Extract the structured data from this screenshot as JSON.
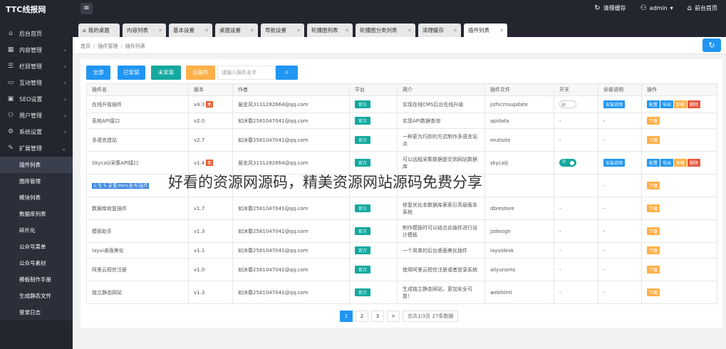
{
  "header": {
    "logo": "TTC线报网",
    "menu_icon": "hamburger-icon",
    "clear_cache": "清理缓存",
    "user": "admin",
    "frontend": "前台首页"
  },
  "sidebar": {
    "items": [
      {
        "label": "后台首页",
        "icon": "home-icon"
      },
      {
        "label": "内容管理",
        "icon": "grid-icon"
      },
      {
        "label": "栏目管理",
        "icon": "list-icon"
      },
      {
        "label": "互动管理",
        "icon": "chat-icon"
      },
      {
        "label": "SEO设置",
        "icon": "monitor-icon"
      },
      {
        "label": "用户管理",
        "icon": "user-icon"
      },
      {
        "label": "系统设置",
        "icon": "gear-icon"
      },
      {
        "label": "扩展管理",
        "icon": "puzzle-icon"
      }
    ],
    "sub_items": [
      "插件列表",
      "图库管理",
      "模块列表",
      "数据库列表",
      "碎片化",
      "公众号菜单",
      "公众号素材",
      "模板制作手册",
      "生成静态文件",
      "登录日志"
    ]
  },
  "tabs": [
    {
      "label": "我的桌面"
    },
    {
      "label": "内容列表"
    },
    {
      "label": "基本设置"
    },
    {
      "label": "桌面设置"
    },
    {
      "label": "导航设置"
    },
    {
      "label": "轮播图列表"
    },
    {
      "label": "轮播图分类列表"
    },
    {
      "label": "清理缓存"
    },
    {
      "label": "插件列表"
    }
  ],
  "breadcrumb": {
    "home": "首页",
    "parent": "插件管理",
    "current": "插件列表"
  },
  "toolbar": {
    "all": "全部",
    "installed": "已安装",
    "uninstalled": "未安装",
    "cloud": "云插件",
    "search_placeholder": "请输入插件名字"
  },
  "table": {
    "headers": [
      "插件名",
      "版本",
      "作者",
      "平台",
      "简介",
      "插件文件",
      "开关",
      "安装说明",
      "操作"
    ],
    "rows": [
      {
        "name": "在线升级插件",
        "version": "v4.3",
        "new": "新",
        "author": "届忠风3131282664@qq.com",
        "platform": "官方",
        "desc": "实现在线CMS后台在线升级",
        "file": "jizhicmsupdate",
        "switch": "off",
        "install_note": "安装说明",
        "ops": [
          "配置",
          "导出",
          "卸载",
          "删除"
        ]
      },
      {
        "name": "系统API接口",
        "version": "v2.0",
        "new": "",
        "author": "如沐春2581047041@qq.com",
        "platform": "官方",
        "desc": "实现API数据查询",
        "file": "apidata",
        "switch": "-",
        "install_note": "-",
        "ops": [
          "下载"
        ]
      },
      {
        "name": "多语言建站",
        "version": "v2.7",
        "new": "",
        "author": "如沐春2581047041@qq.com",
        "platform": "官方",
        "desc": "一种更为巧妙的方式制作多语言站点",
        "file": "mutisite",
        "switch": "-",
        "install_note": "-",
        "ops": [
          "下载"
        ]
      },
      {
        "name": "Skycaiji采集API接口",
        "version": "v1.4",
        "new": "新",
        "author": "届忠风3131282664@qq.com",
        "platform": "官方",
        "desc": "可以远程采集数据提交到网站数据库",
        "file": "skycaiji",
        "switch": "on",
        "switch_label": "开",
        "install_note": "安装说明",
        "ops": [
          "配置",
          "导出",
          "卸载",
          "删除"
        ]
      },
      {
        "name": "火车头采集Web发布插件",
        "version": "",
        "new": "",
        "author": "",
        "platform": "",
        "desc": "",
        "file": "",
        "switch": "",
        "install_note": "-",
        "ops": [
          "下载"
        ]
      },
      {
        "name": "数据库修复插件",
        "version": "v1.7",
        "new": "",
        "author": "如沐春2581047041@qq.com",
        "platform": "官方",
        "desc": "修复优化本数据库表索引高级版本系统",
        "file": "dbrestore",
        "switch": "-",
        "install_note": "-",
        "ops": [
          "下载"
        ]
      },
      {
        "name": "模板助手",
        "version": "v1.3",
        "new": "",
        "author": "如沐春2581047041@qq.com",
        "platform": "官方",
        "desc": "制作模板时可以结合此插件进行设计模板",
        "file": "jzdesign",
        "switch": "-",
        "install_note": "-",
        "ops": [
          "下载"
        ]
      },
      {
        "name": "layui桌面美化",
        "version": "v1.1",
        "new": "",
        "author": "如沐春2581047041@qq.com",
        "platform": "官方",
        "desc": "一个简单的后台桌面美化插件",
        "file": "layuidesk",
        "switch": "-",
        "install_note": "-",
        "ops": [
          "下载"
        ]
      },
      {
        "name": "阿里云短信注册",
        "version": "v1.0",
        "new": "",
        "author": "如沐春2581047041@qq.com",
        "platform": "官方",
        "desc": "使用阿里云短信注册或者登录系统",
        "file": "aliyunsms",
        "switch": "-",
        "install_note": "-",
        "ops": [
          "下载"
        ]
      },
      {
        "name": "独立静态网站",
        "version": "v1.3",
        "new": "",
        "author": "如沐春2581047041@qq.com",
        "platform": "官方",
        "desc": "生成独立静态网站，更加安全可靠！",
        "file": "webhtml",
        "switch": "-",
        "install_note": "-",
        "ops": [
          "下载"
        ]
      }
    ]
  },
  "pagination": {
    "pages": [
      "1",
      "2",
      "3"
    ],
    "next": ">",
    "info": "总共1/3页 27条数据"
  },
  "watermark": "好看的资源网源码，精美资源网站源码免费分享",
  "colors": {
    "sidebar_bg": "#23262e",
    "primary": "#2196f3",
    "teal": "#13a89e",
    "orange": "#ffb049",
    "red": "#e8543d"
  }
}
